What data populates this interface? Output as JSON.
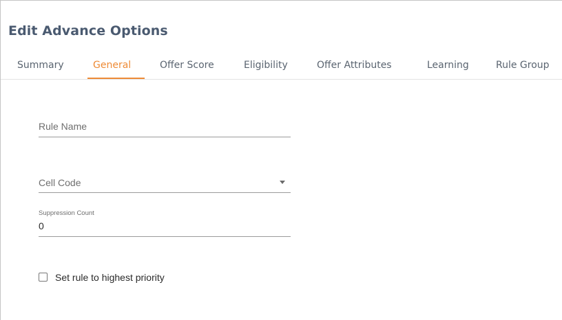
{
  "dialog": {
    "title": "Edit Advance Options"
  },
  "tabs": [
    {
      "label": "Summary",
      "active": false
    },
    {
      "label": "General",
      "active": true
    },
    {
      "label": "Offer Score",
      "active": false
    },
    {
      "label": "Eligibility",
      "active": false
    },
    {
      "label": "Offer Attributes",
      "active": false
    },
    {
      "label": "Learning",
      "active": false
    },
    {
      "label": "Rule Group",
      "active": false
    }
  ],
  "form": {
    "rule_name": {
      "label": "Rule Name",
      "value": ""
    },
    "cell_code": {
      "label": "Cell Code",
      "value": ""
    },
    "suppression_count": {
      "label": "Suppression Count",
      "value": "0"
    },
    "highest_priority": {
      "label": "Set rule to highest priority",
      "checked": false
    }
  },
  "colors": {
    "accent": "#ee8a35",
    "title": "#4a5a70",
    "tab_text": "#5a6470"
  }
}
